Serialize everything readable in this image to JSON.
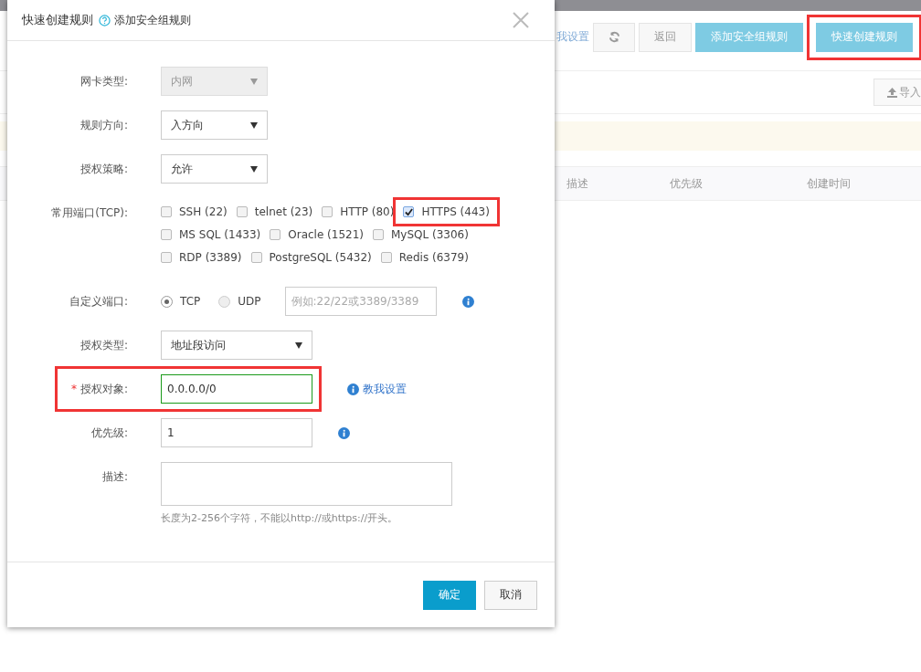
{
  "page": {
    "help_link": "我设置",
    "toolbar_buttons": [
      {
        "kind": "refresh"
      },
      {
        "kind": "plain",
        "label": "返回"
      },
      {
        "kind": "primary",
        "label": "添加安全组规则"
      },
      {
        "kind": "primary",
        "label": "快速创建规则",
        "highlighted": true
      }
    ],
    "import_button": "导入",
    "table": {
      "columns": [
        "描述",
        "优先级",
        "创建时间"
      ]
    }
  },
  "dialog": {
    "title": "快速创建规则",
    "subtitle": "添加安全组规则",
    "fields": [
      {
        "kind": "select",
        "label": "网卡类型:",
        "value": "内网",
        "disabled": true
      },
      {
        "kind": "select",
        "label": "规则方向:",
        "value": "入方向",
        "disabled": false
      },
      {
        "kind": "select",
        "label": "授权策略:",
        "value": "允许",
        "disabled": false
      },
      {
        "kind": "ports",
        "label": "常用端口(TCP):",
        "rows": [
          [
            {
              "label": "SSH (22)",
              "checked": false
            },
            {
              "label": "telnet (23)",
              "checked": false
            },
            {
              "label": "HTTP (80)",
              "checked": false
            },
            {
              "label": "HTTPS (443)",
              "checked": true,
              "highlighted": true
            }
          ],
          [
            {
              "label": "MS SQL (1433)",
              "checked": false
            },
            {
              "label": "Oracle (1521)",
              "checked": false
            },
            {
              "label": "MySQL (3306)",
              "checked": false
            }
          ],
          [
            {
              "label": "RDP (3389)",
              "checked": false
            },
            {
              "label": "PostgreSQL (5432)",
              "checked": false
            },
            {
              "label": "Redis (6379)",
              "checked": false
            }
          ]
        ]
      },
      {
        "kind": "custom_port",
        "label": "自定义端口:",
        "options": [
          {
            "label": "TCP",
            "selected": true
          },
          {
            "label": "UDP",
            "selected": false
          }
        ],
        "placeholder": "例如:22/22或3389/3389",
        "info": true
      },
      {
        "kind": "select",
        "label": "授权类型:",
        "value": "地址段访问",
        "disabled": false,
        "wide": true
      },
      {
        "kind": "input",
        "label": "授权对象:",
        "required_mark": "*",
        "value": "0.0.0.0/0",
        "valid": true,
        "highlighted": true,
        "info": true,
        "link": "教我设置"
      },
      {
        "kind": "input",
        "label": "优先级:",
        "value": "1",
        "valid": false,
        "info": true
      },
      {
        "kind": "textarea",
        "label": "描述:",
        "hint": "长度为2-256个字符，不能以http://或https://开头。"
      }
    ],
    "buttons": [
      {
        "kind": "primary",
        "label": "确定"
      },
      {
        "kind": "plain",
        "label": "取消"
      }
    ]
  }
}
